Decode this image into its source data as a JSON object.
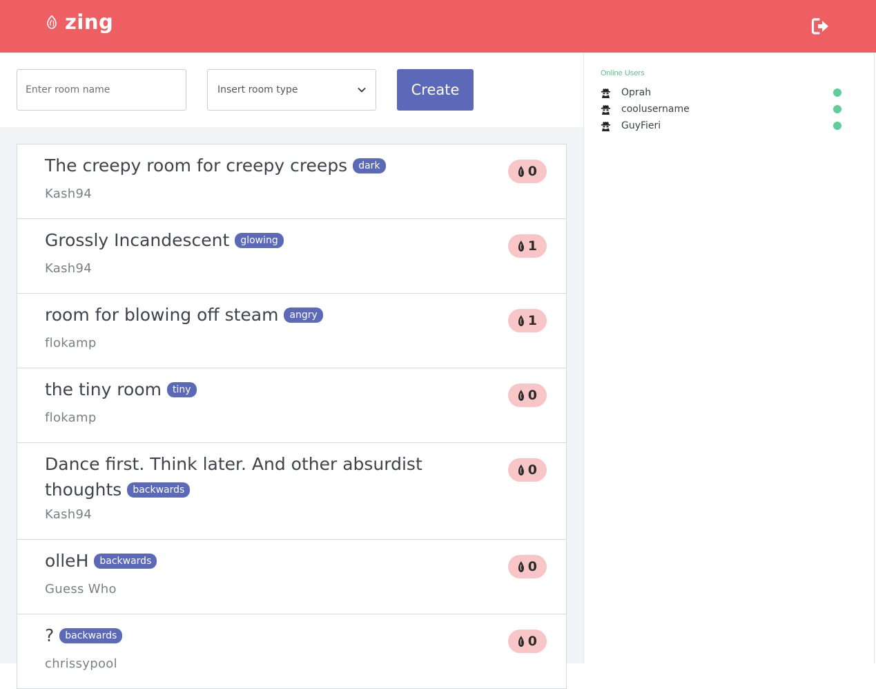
{
  "app": {
    "name": "zing"
  },
  "header": {
    "logout_icon": "sign-out-icon",
    "logo_icon": "flame-icon"
  },
  "form": {
    "room_name_placeholder": "Enter room name",
    "room_type_placeholder": "Insert room type",
    "create_label": "Create"
  },
  "rooms": [
    {
      "title": "The creepy room for creepy creeps",
      "tag": "dark",
      "owner": "Kash94",
      "count": "0"
    },
    {
      "title": "Grossly Incandescent",
      "tag": "glowing",
      "owner": "Kash94",
      "count": "1"
    },
    {
      "title": "room for blowing off steam",
      "tag": "angry",
      "owner": "flokamp",
      "count": "1"
    },
    {
      "title": "the tiny room",
      "tag": "tiny",
      "owner": "flokamp",
      "count": "0"
    },
    {
      "title": "Dance first. Think later. And other absurdist thoughts",
      "tag": "backwards",
      "owner": "Kash94",
      "count": "0"
    },
    {
      "title": "olleH",
      "tag": "backwards",
      "owner": "Guess Who",
      "count": "0"
    },
    {
      "title": "?",
      "tag": "backwards",
      "owner": "chrissypool",
      "count": "0"
    }
  ],
  "sidebar": {
    "title": "Online Users",
    "users": [
      {
        "name": "Oprah",
        "status": "online"
      },
      {
        "name": "coolusername",
        "status": "online"
      },
      {
        "name": "GuyFieri",
        "status": "online"
      }
    ],
    "status_color": "#5fcf97"
  },
  "colors": {
    "brand": "#ee5f63",
    "accent": "#5b69b8",
    "pill": "#f9c6c7"
  }
}
